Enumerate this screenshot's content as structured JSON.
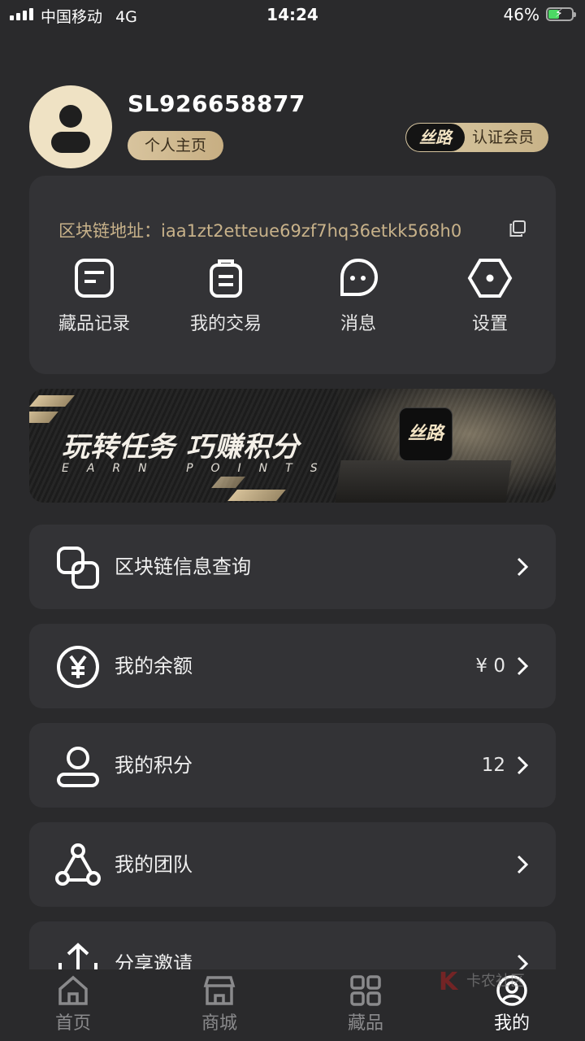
{
  "status_bar": {
    "carrier": "中国移动",
    "network": "4G",
    "time": "14:24",
    "battery": "46%",
    "battery_level": 0.46
  },
  "profile": {
    "username": "SL926658877",
    "home_button": "个人主页",
    "member_badge_logo": "丝路",
    "member_badge_label": "认证会员"
  },
  "card": {
    "chain_address_label": "区块链地址：",
    "chain_address": "iaa1zt2etteue69zf7hq36etkk568h0",
    "quick_actions": [
      {
        "label": "藏品记录",
        "icon": "document-icon"
      },
      {
        "label": "我的交易",
        "icon": "clipboard-icon"
      },
      {
        "label": "消息",
        "icon": "chat-bubble-icon"
      },
      {
        "label": "设置",
        "icon": "hexagon-settings-icon"
      }
    ]
  },
  "banner": {
    "title": "玩转任务 巧赚积分",
    "subtitle": "EARN POINTS",
    "logo": "丝路"
  },
  "menu": [
    {
      "label": "区块链信息查询",
      "value": "",
      "icon": "overlap-squares-icon"
    },
    {
      "label": "我的余额",
      "value": "¥ 0",
      "icon": "yen-circle-icon"
    },
    {
      "label": "我的积分",
      "value": "12",
      "icon": "user-points-icon"
    },
    {
      "label": "我的团队",
      "value": "",
      "icon": "team-icon"
    },
    {
      "label": "分享邀请",
      "value": "",
      "icon": "share-icon"
    }
  ],
  "tabbar": [
    {
      "label": "首页",
      "icon": "home-icon",
      "active": false
    },
    {
      "label": "商城",
      "icon": "shop-icon",
      "active": false
    },
    {
      "label": "藏品",
      "icon": "grid-icon",
      "active": false
    },
    {
      "label": "我的",
      "icon": "profile-icon",
      "active": true
    }
  ],
  "watermark": {
    "mark": "K",
    "text": "卡农社区"
  },
  "colors": {
    "background": "#2a2a2c",
    "card": "#333336",
    "gold": "#c8b28a",
    "battery_green": "#4cd964"
  }
}
